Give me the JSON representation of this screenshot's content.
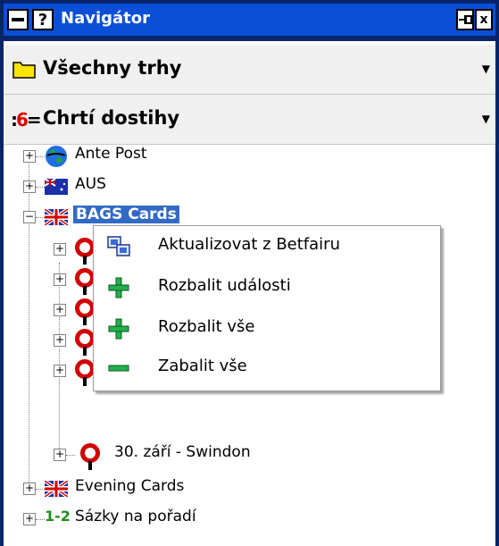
{
  "window": {
    "title": "Navigátor",
    "icons": {
      "left_a": "window-menu-icon",
      "left_b": "help-icon",
      "pin": "pin-icon",
      "close": "close-icon"
    },
    "help_glyph": "?",
    "close_glyph": "x"
  },
  "combos": [
    {
      "label": "Všechny trhy",
      "icon": "folder-icon"
    },
    {
      "label": "Chrtí dostihy",
      "icon": "greyhound-icon",
      "icon_text": "6"
    }
  ],
  "tree": {
    "items": [
      {
        "label": "Ante Post",
        "icon": "globe-icon",
        "expander": "+"
      },
      {
        "label": "AUS",
        "icon": "australia-flag-icon",
        "expander": "+"
      },
      {
        "label": "BAGS Cards",
        "icon": "uk-flag-icon",
        "expander": "−",
        "selected": true
      },
      {
        "label": "30. září - Swindon",
        "icon": "venue-pin-icon",
        "expander": "+"
      },
      {
        "label": "Evening Cards",
        "icon": "uk-flag-icon",
        "expander": "+"
      },
      {
        "label": "Sázky na pořadí",
        "icon": "forecast-icon",
        "icon_text": "1-2",
        "expander": "+"
      }
    ]
  },
  "context_menu": {
    "items": [
      {
        "label": "Aktualizovat z Betfairu",
        "icon": "refresh-icon"
      },
      {
        "label": "Rozbalit události",
        "icon": "expand-events-icon"
      },
      {
        "label": "Rozbalit vše",
        "icon": "expand-all-icon"
      },
      {
        "label": "Zabalit vše",
        "icon": "collapse-all-icon"
      }
    ]
  },
  "colors": {
    "titlebar": "#0a4fd6",
    "selection": "#316ac5",
    "plus_green": "#22b14c",
    "pin_red": "#d20000"
  }
}
